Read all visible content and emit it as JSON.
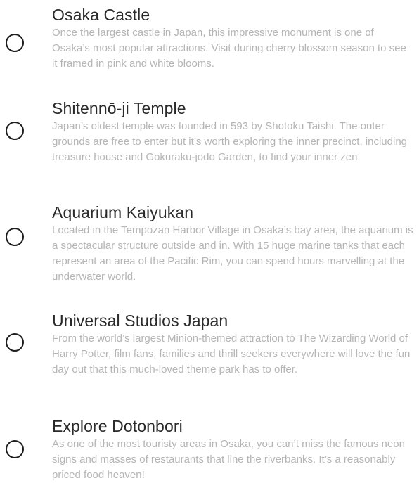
{
  "attractions": [
    {
      "title": "Osaka Castle",
      "description": "Once the largest castle in Japan, this impressive monument is one of Osaka’s most popular attractions. Visit during cherry blossom season to see it framed in pink and white blooms."
    },
    {
      "title": "Shitennō-ji Temple",
      "description": "Japan’s oldest temple was founded in 593 by Shotoku Taishi. The outer grounds are free to enter but it’s worth exploring the inner precinct, including treasure house and Gokuraku-jodo Garden, to find your inner zen."
    },
    {
      "title": "Aquarium Kaiyukan",
      "description": "Located in the Tempozan Harbor Village in Osaka’s bay area, the aquarium is a spectacular structure outside and in. With 15 huge marine tanks that each represent an area of the Pacific Rim, you can spend hours marvelling at the underwater world."
    },
    {
      "title": "Universal Studios Japan",
      "description": "From the world’s largest Minion-themed attraction to The Wizarding World of Harry Potter, film fans, families and thrill seekers everywhere will love the fun day out that this much-loved theme park has to offer."
    },
    {
      "title": "Explore Dotonbori",
      "description": "As one of the most touristy areas in Osaka, you can’t miss the famous neon signs and masses of restaurants that line the riverbanks. It’s a reasonably priced food heaven!"
    }
  ]
}
